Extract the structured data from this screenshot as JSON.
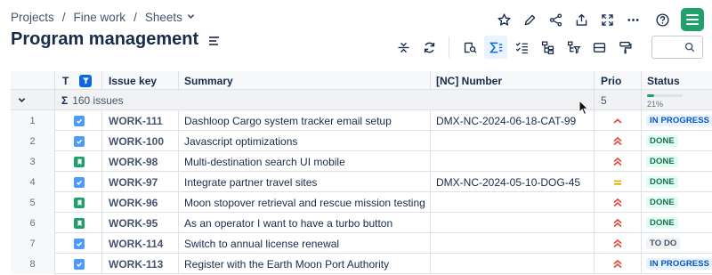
{
  "breadcrumb": {
    "items": [
      "Projects",
      "Fine work",
      "Sheets"
    ]
  },
  "page": {
    "title": "Program management"
  },
  "top_actions": [
    "star-icon",
    "edit-icon",
    "share-icon",
    "export-icon",
    "fullscreen-icon",
    "more-icon",
    "help-icon"
  ],
  "toolbar_icons": [
    "collapse-rows-icon",
    "refresh-icon",
    "issue-search-icon",
    "sum-icon",
    "checklist-icon",
    "hierarchy-icon",
    "hierarchy-filter-icon",
    "row-height-icon",
    "format-painter-icon"
  ],
  "search": {
    "value": ""
  },
  "columns": {
    "type": "T",
    "key": "Issue key",
    "summary": "Summary",
    "nc": "[NC] Number",
    "prio": "Prio",
    "status": "Status"
  },
  "group": {
    "sigma": "Σ",
    "count_label": "160 issues",
    "prio_value": "5",
    "progress_label": "21%",
    "progress_fraction": 0.21
  },
  "rows": [
    {
      "n": "1",
      "type": "task",
      "key": "WORK-111",
      "summary": "Dashloop Cargo system tracker email setup",
      "nc": "DMX-NC-2024-06-18-CAT-99",
      "prio": "high",
      "status": "IN PROGRESS",
      "status_kind": "prog"
    },
    {
      "n": "2",
      "type": "task",
      "key": "WORK-100",
      "summary": "Javascript optimizations",
      "nc": "",
      "prio": "highest",
      "status": "DONE",
      "status_kind": "done"
    },
    {
      "n": "3",
      "type": "story",
      "key": "WORK-98",
      "summary": "Multi-destination search UI mobile",
      "nc": "",
      "prio": "highest",
      "status": "DONE",
      "status_kind": "done"
    },
    {
      "n": "4",
      "type": "task",
      "key": "WORK-97",
      "summary": "Integrate partner travel sites",
      "nc": "DMX-NC-2024-05-10-DOG-45",
      "prio": "medium",
      "status": "DONE",
      "status_kind": "done"
    },
    {
      "n": "5",
      "type": "story",
      "key": "WORK-96",
      "summary": "Moon stopover retrieval and rescue mission testing",
      "nc": "",
      "prio": "highest",
      "status": "DONE",
      "status_kind": "done"
    },
    {
      "n": "6",
      "type": "story",
      "key": "WORK-95",
      "summary": "As an operator I want to have a turbo button",
      "nc": "",
      "prio": "highest",
      "status": "DONE",
      "status_kind": "done"
    },
    {
      "n": "7",
      "type": "task",
      "key": "WORK-114",
      "summary": "Switch to annual license renewal",
      "nc": "",
      "prio": "highest",
      "status": "TO DO",
      "status_kind": "todo"
    },
    {
      "n": "8",
      "type": "task",
      "key": "WORK-113",
      "summary": "Register with the Earth Moon Port Authority",
      "nc": "",
      "prio": "highest",
      "status": "IN PROGRESS",
      "status_kind": "prog"
    }
  ],
  "colors": {
    "accent": "#0c66e4",
    "done": "#216e4e",
    "in_progress": "#0055cc",
    "prio_high": "#e2483d",
    "prio_medium": "#e2b203",
    "app_logo": "#22a06b"
  }
}
